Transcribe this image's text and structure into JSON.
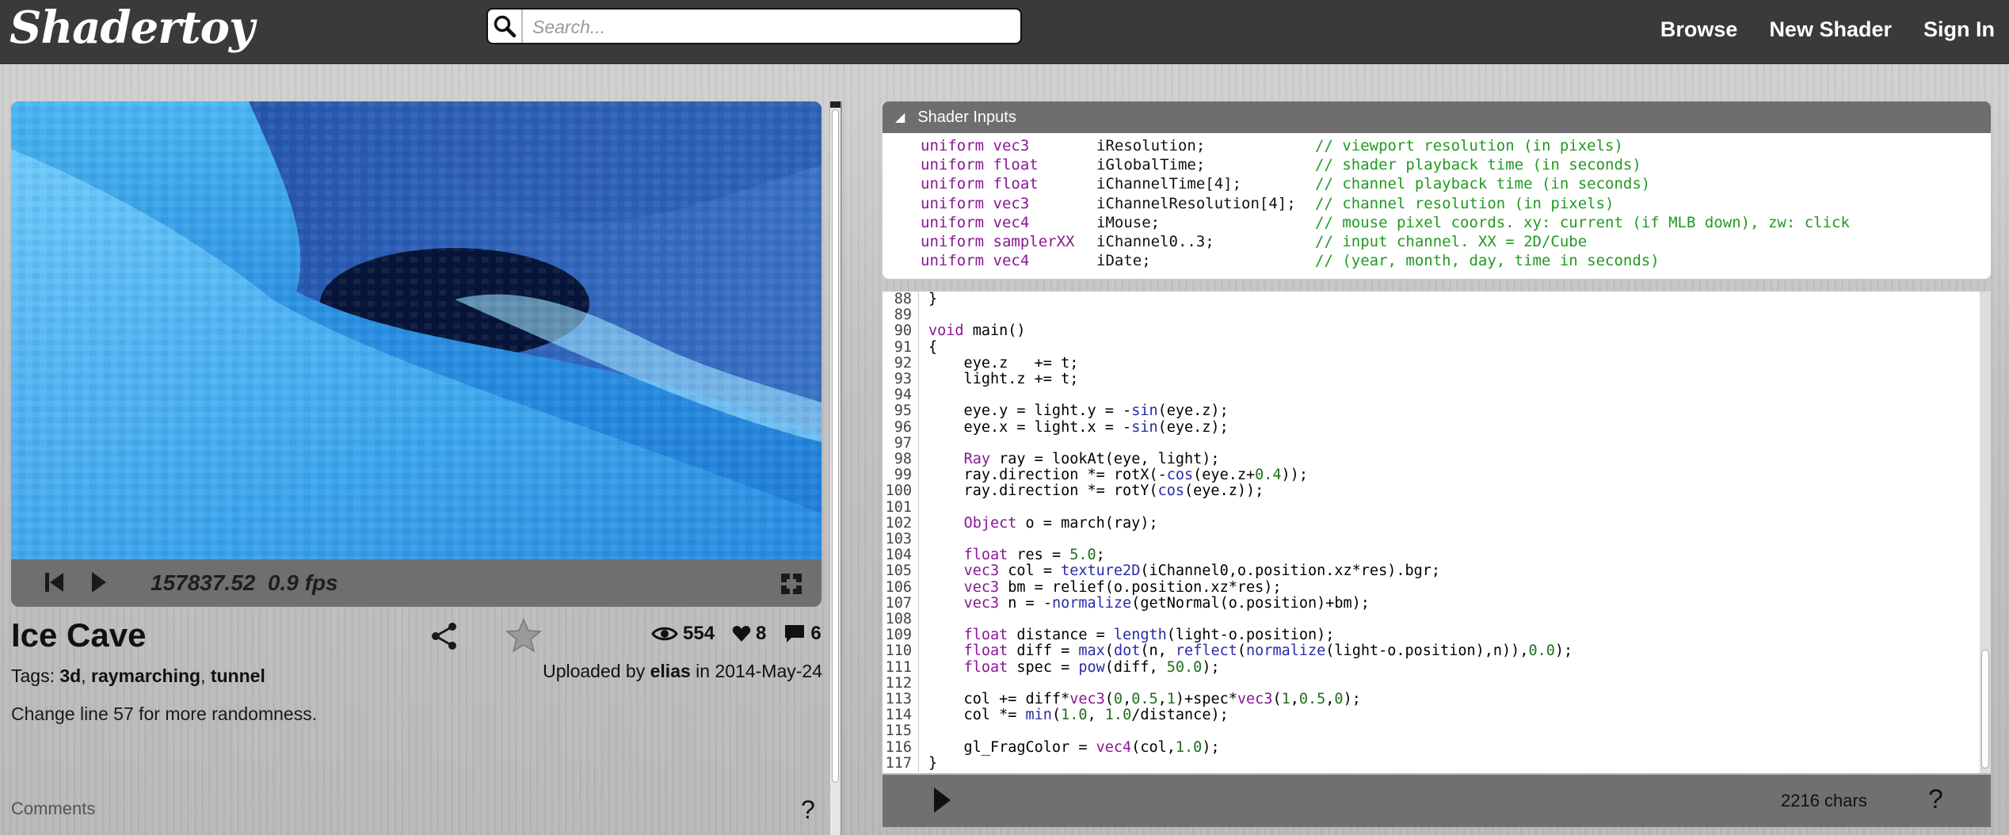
{
  "header": {
    "logo": "Shadertoy",
    "search_placeholder": "Search...",
    "nav": [
      "Browse",
      "New Shader",
      "Sign In"
    ]
  },
  "player": {
    "time": "157837.52",
    "fps": "0.9 fps"
  },
  "shader": {
    "title": "Ice Cave",
    "views": "554",
    "likes": "8",
    "comments_count": "6",
    "tags_label": "Tags:",
    "tags": [
      "3d",
      "raymarching",
      "tunnel"
    ],
    "uploaded_prefix": "Uploaded by",
    "author": "elias",
    "uploaded_in": "in",
    "date": "2014-May-24",
    "description": "Change line 57 for more randomness."
  },
  "comments": {
    "label": "Comments",
    "help": "?"
  },
  "inputs_panel": {
    "title": "Shader Inputs",
    "rows": [
      {
        "type": "uniform vec3",
        "name": "iResolution;",
        "comment": "// viewport resolution (in pixels)"
      },
      {
        "type": "uniform float",
        "name": "iGlobalTime;",
        "comment": "// shader playback time (in seconds)"
      },
      {
        "type": "uniform float",
        "name": "iChannelTime[4];",
        "comment": "// channel playback time (in seconds)"
      },
      {
        "type": "uniform vec3",
        "name": "iChannelResolution[4];",
        "comment": "// channel resolution (in pixels)"
      },
      {
        "type": "uniform vec4",
        "name": "iMouse;",
        "comment": "// mouse pixel coords. xy: current (if MLB down), zw: click"
      },
      {
        "type": "uniform samplerXX",
        "name": "iChannel0..3;",
        "comment": "// input channel. XX = 2D/Cube"
      },
      {
        "type": "uniform vec4",
        "name": "iDate;",
        "comment": "// (year, month, day, time in seconds)"
      }
    ]
  },
  "code": {
    "lines": [
      {
        "num": "88",
        "text": "}"
      },
      {
        "num": "89",
        "text": ""
      },
      {
        "num": "90",
        "text": "void main()"
      },
      {
        "num": "91",
        "text": "{"
      },
      {
        "num": "92",
        "text": "    eye.z   += t;"
      },
      {
        "num": "93",
        "text": "    light.z += t;"
      },
      {
        "num": "94",
        "text": ""
      },
      {
        "num": "95",
        "text": "    eye.y = light.y = -sin(eye.z);"
      },
      {
        "num": "96",
        "text": "    eye.x = light.x = -sin(eye.z);"
      },
      {
        "num": "97",
        "text": ""
      },
      {
        "num": "98",
        "text": "    Ray ray = lookAt(eye, light);"
      },
      {
        "num": "99",
        "text": "    ray.direction *= rotX(-cos(eye.z+0.4));"
      },
      {
        "num": "100",
        "text": "    ray.direction *= rotY(cos(eye.z));"
      },
      {
        "num": "101",
        "text": ""
      },
      {
        "num": "102",
        "text": "    Object o = march(ray);"
      },
      {
        "num": "103",
        "text": ""
      },
      {
        "num": "104",
        "text": "    float res = 5.0;"
      },
      {
        "num": "105",
        "text": "    vec3 col = texture2D(iChannel0,o.position.xz*res).bgr;"
      },
      {
        "num": "106",
        "text": "    vec3 bm = relief(o.position.xz*res);"
      },
      {
        "num": "107",
        "text": "    vec3 n = -normalize(getNormal(o.position)+bm);"
      },
      {
        "num": "108",
        "text": ""
      },
      {
        "num": "109",
        "text": "    float distance = length(light-o.position);"
      },
      {
        "num": "110",
        "text": "    float diff = max(dot(n, reflect(normalize(light-o.position),n)),0.0);"
      },
      {
        "num": "111",
        "text": "    float spec = pow(diff, 50.0);"
      },
      {
        "num": "112",
        "text": ""
      },
      {
        "num": "113",
        "text": "    col += diff*vec3(0,0.5,1)+spec*vec3(1,0.5,0);"
      },
      {
        "num": "114",
        "text": "    col *= min(1.0, 1.0/distance);"
      },
      {
        "num": "115",
        "text": ""
      },
      {
        "num": "116",
        "text": "    gl_FragColor = vec4(col,1.0);"
      },
      {
        "num": "117",
        "text": "}"
      }
    ],
    "char_count": "2216 chars",
    "help": "?"
  },
  "icons": {
    "search": "search-icon",
    "rewind": "rewind-icon",
    "play": "play-icon",
    "fullscreen": "fullscreen-icon",
    "share": "share-icon",
    "star": "star-icon",
    "eye": "eye-icon",
    "heart": "heart-icon",
    "comment": "comment-icon"
  },
  "colors": {
    "topbar": "#3a3a3a",
    "keyword": "#8a1696",
    "comment": "#1f9a1f",
    "number": "#1f6f1f",
    "function": "#2a2aa8"
  }
}
